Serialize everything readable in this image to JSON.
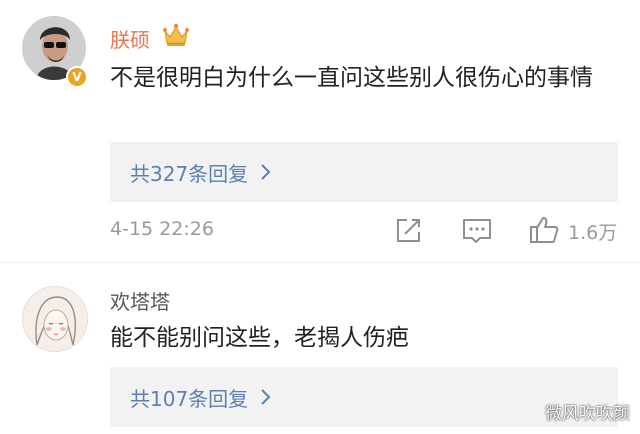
{
  "comments": [
    {
      "username": "朕硕",
      "text": "不是很明白为什么一直问这些别人很伤心的事情",
      "replies_label": "共327条回复",
      "timestamp": "4-15 22:26",
      "likes": "1.6万",
      "verified_badge": "V",
      "icons": [
        "crown-icon",
        "chevron-right-icon",
        "share-icon",
        "comment-icon",
        "like-icon"
      ]
    },
    {
      "username": "欢塔塔",
      "text": "能不能别问这些，老揭人伤疤",
      "replies_label": "共107条回复",
      "icons": [
        "chevron-right-icon"
      ]
    }
  ],
  "watermark": "微风吹吹颜",
  "colors": {
    "vip_name": "#eb7350",
    "link": "#5b80b2",
    "muted": "#999999",
    "reply_bg": "#f2f2f2",
    "badge": "#f0a21f"
  }
}
